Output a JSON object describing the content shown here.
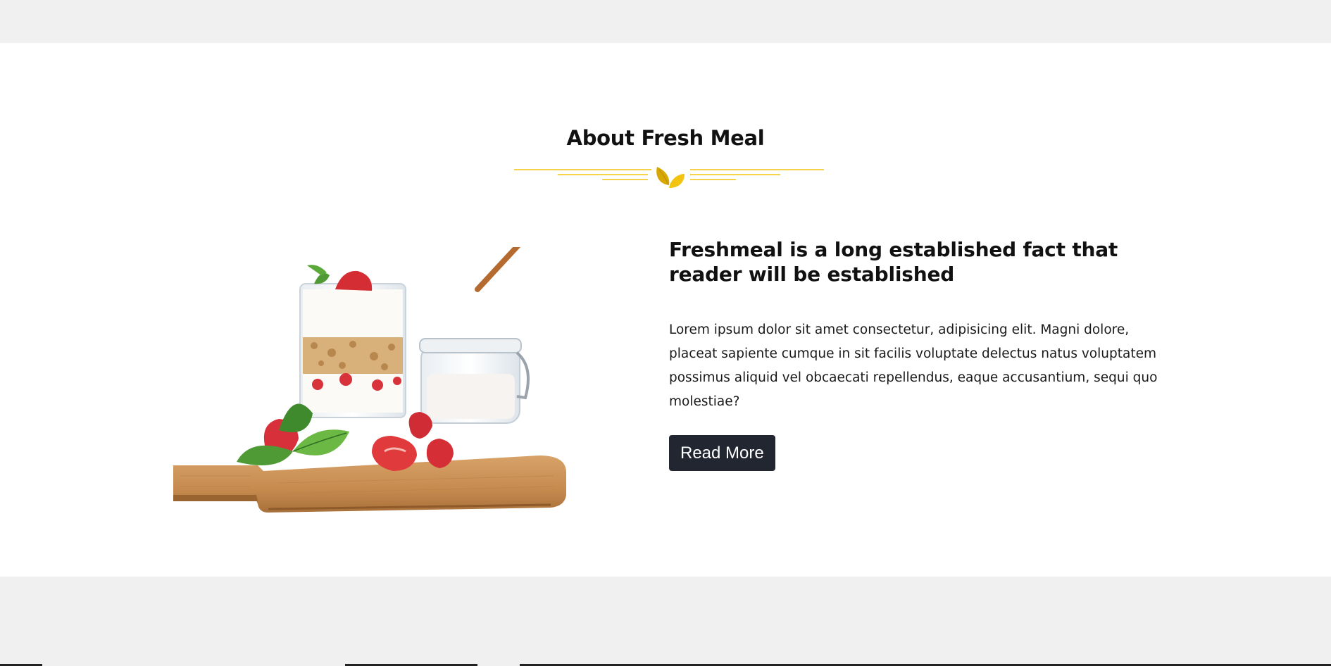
{
  "about": {
    "title": "About Fresh Meal",
    "heading": "Freshmeal is a long established fact that reader will be established",
    "paragraph": "Lorem ipsum dolor sit amet consectetur, adipisicing elit. Magni dolore, placeat sapiente cumque in sit facilis voluptate delectus natus voluptatem possimus aliquid vel obcaecati repellendus, eaque accusantium, sequi quo molestiae?",
    "button_label": "Read More"
  },
  "icons": {
    "divider": "leaf-icon",
    "image": "yogurt-parfait-image"
  },
  "colors": {
    "accent": "#f2c40f",
    "button": "#212630",
    "page_bg": "#f0f0f0",
    "section_bg": "#ffffff"
  }
}
